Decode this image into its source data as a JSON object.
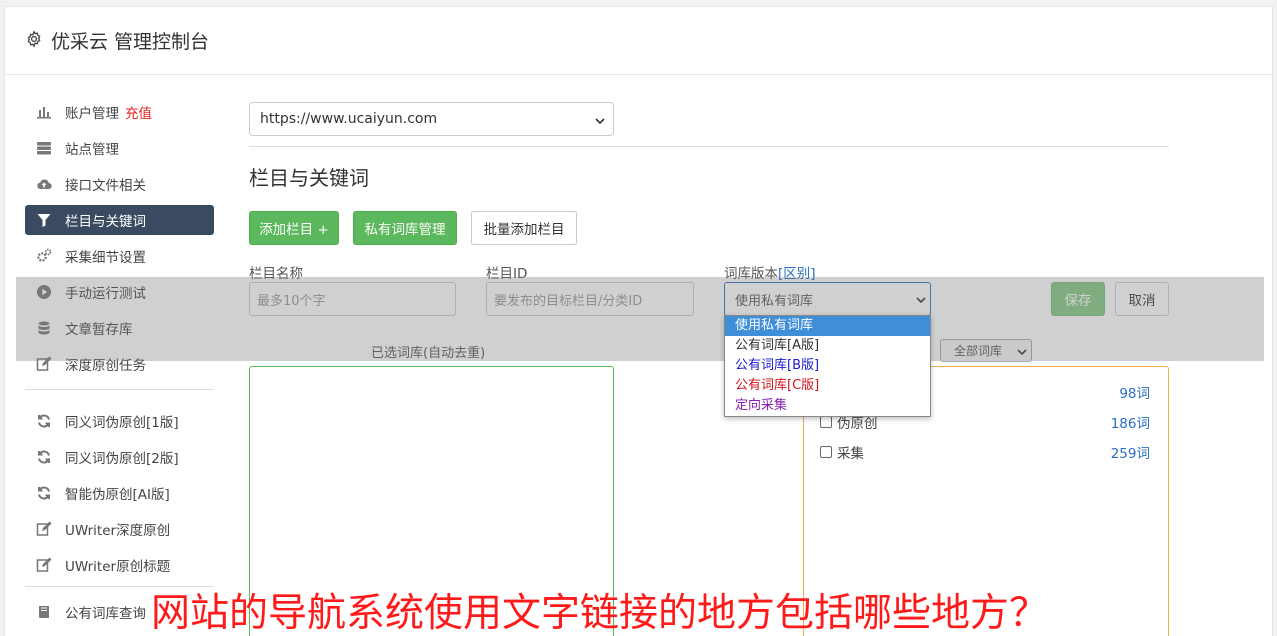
{
  "header": {
    "title": "优采云 管理控制台",
    "icon": "gear-icon"
  },
  "sidebar": {
    "items": [
      {
        "label": "账户管理",
        "badge": "充值",
        "icon": "bar-chart-icon"
      },
      {
        "label": "站点管理",
        "icon": "server-icon"
      },
      {
        "label": "接口文件相关",
        "icon": "cloud-upload-icon"
      },
      {
        "label": "栏目与关键词",
        "icon": "filter-icon",
        "active": true
      },
      {
        "label": "采集细节设置",
        "icon": "gears-icon"
      },
      {
        "label": "手动运行测试",
        "icon": "play-circle-icon"
      },
      {
        "label": "文章暂存库",
        "icon": "database-icon"
      },
      {
        "label": "深度原创任务",
        "icon": "edit-icon"
      }
    ],
    "items2": [
      {
        "label": "同义词伪原创[1版]",
        "icon": "refresh-icon"
      },
      {
        "label": "同义词伪原创[2版]",
        "icon": "refresh-icon"
      },
      {
        "label": "智能伪原创[AI版]",
        "icon": "refresh-icon"
      },
      {
        "label": "UWriter深度原创",
        "icon": "edit-icon"
      },
      {
        "label": "UWriter原创标题",
        "icon": "edit-icon"
      },
      {
        "label": "公有词库查询",
        "icon": "book-icon"
      }
    ]
  },
  "main": {
    "site_select": "https://www.ucaiyun.com",
    "section_title": "栏目与关键词",
    "buttons": {
      "add_column": "添加栏目 +",
      "private_lib": "私有词库管理",
      "batch_add": "批量添加栏目",
      "save": "保存",
      "cancel": "取消"
    },
    "form": {
      "name_label": "栏目名称",
      "name_placeholder": "最多10个字",
      "id_label": "栏目ID",
      "id_placeholder": "要发布的目标栏目/分类ID",
      "version_label": "词库版本",
      "version_link": "[区别]",
      "version_value": "使用私有词库"
    },
    "dropdown_options": [
      {
        "label": "使用私有词库",
        "color": "#ffffff"
      },
      {
        "label": "公有词库[A版]",
        "color": "#333333"
      },
      {
        "label": "公有词库[B版]",
        "color": "#1a1acc"
      },
      {
        "label": "公有词库[C版]",
        "color": "#d0161c"
      },
      {
        "label": "定向采集",
        "color": "#8a1fb0"
      }
    ],
    "selected_caption": "已选词库(自动去重)",
    "filter_select": "全部词库",
    "library": [
      {
        "label": "",
        "count": "98词"
      },
      {
        "label": "伪原创",
        "count": "186词"
      },
      {
        "label": "采集",
        "count": "259词"
      }
    ]
  },
  "overlay_caption": "网站的导航系统使用文字链接的地方包括哪些地方？"
}
